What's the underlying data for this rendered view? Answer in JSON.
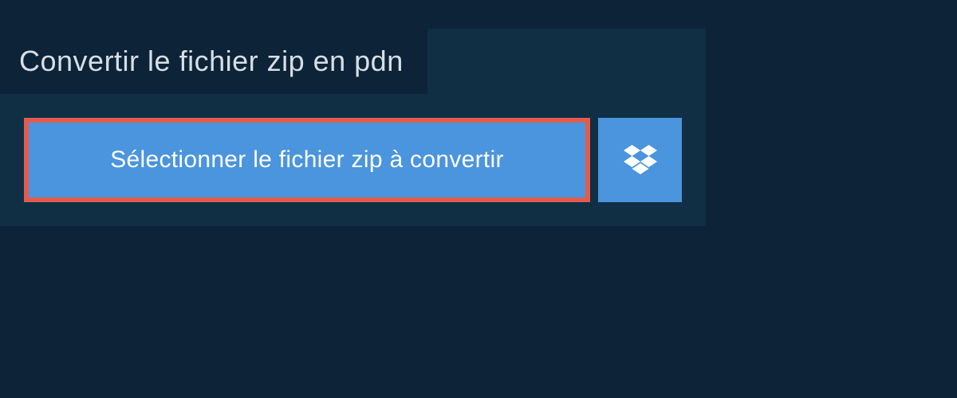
{
  "header": {
    "title": "Convertir le fichier zip en pdn"
  },
  "actions": {
    "select_file_label": "Sélectionner le fichier zip à convertir"
  },
  "colors": {
    "background": "#0d2338",
    "panel": "#102e44",
    "button_primary": "#4a95dd",
    "highlight_border": "#e25b4f",
    "text_light": "#d8dfe5",
    "text_white": "#ffffff"
  }
}
